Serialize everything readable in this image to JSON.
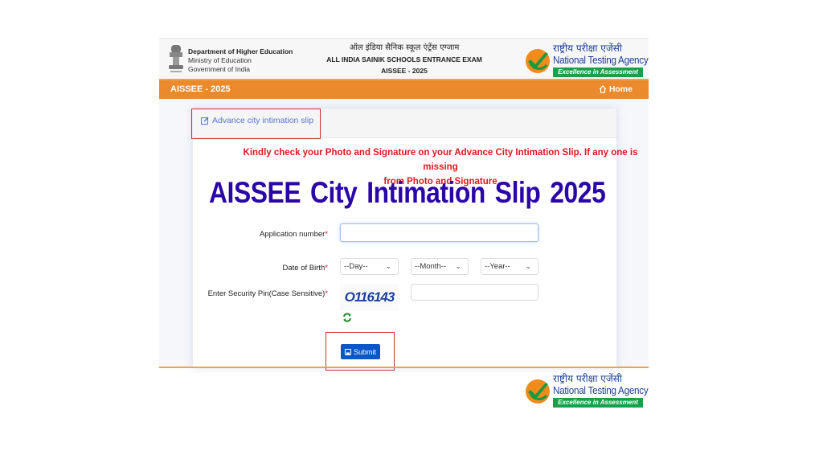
{
  "header": {
    "dept_line1": "Department of Higher Education",
    "dept_line2": "Ministry of Education",
    "dept_line3": "Government of India",
    "exam_hindi": "ऑल इंडिया सैनिक स्कूल एंट्रेंस एग्जाम",
    "exam_english": "ALL INDIA SAINIK SCHOOLS ENTRANCE EXAM",
    "exam_year": "AISSEE - 2025",
    "nta_hindi": "राष्ट्रीय परीक्षा एजेंसी",
    "nta_english": "National Testing Agency",
    "nta_tagline": "Excellence in Assessment"
  },
  "navbar": {
    "brand": "AISSEE - 2025",
    "home_label": "Home",
    "home_icon": "home-icon"
  },
  "card": {
    "tab_label": "Advance city intimation slip",
    "tab_icon": "edit-icon",
    "notice_line1": "Kindly check your Photo and Signature on your Advance City Intimation Slip. If any one is missing",
    "notice_line2": "from Photo and Signature",
    "title": "AISSEE  City Intimation Slip 2025"
  },
  "form": {
    "application_label": "Application number",
    "application_value": "",
    "dob_label": "Date of Birth",
    "day_selected": "--Day--",
    "month_selected": "--Month--",
    "year_selected": "--Year--",
    "pin_label": "Enter Security Pin(Case Sensitive)",
    "required_mark": "*",
    "captcha_text": "O116143",
    "pin_value": "",
    "refresh_icon": "refresh-icon",
    "submit_label": "Submit",
    "submit_icon": "save-icon"
  },
  "colors": {
    "navbar": "#ea8a2c",
    "title": "#2a06a8",
    "notice": "#e3161e",
    "submit": "#0b57c9",
    "highlight_box": "#d32f2f"
  }
}
